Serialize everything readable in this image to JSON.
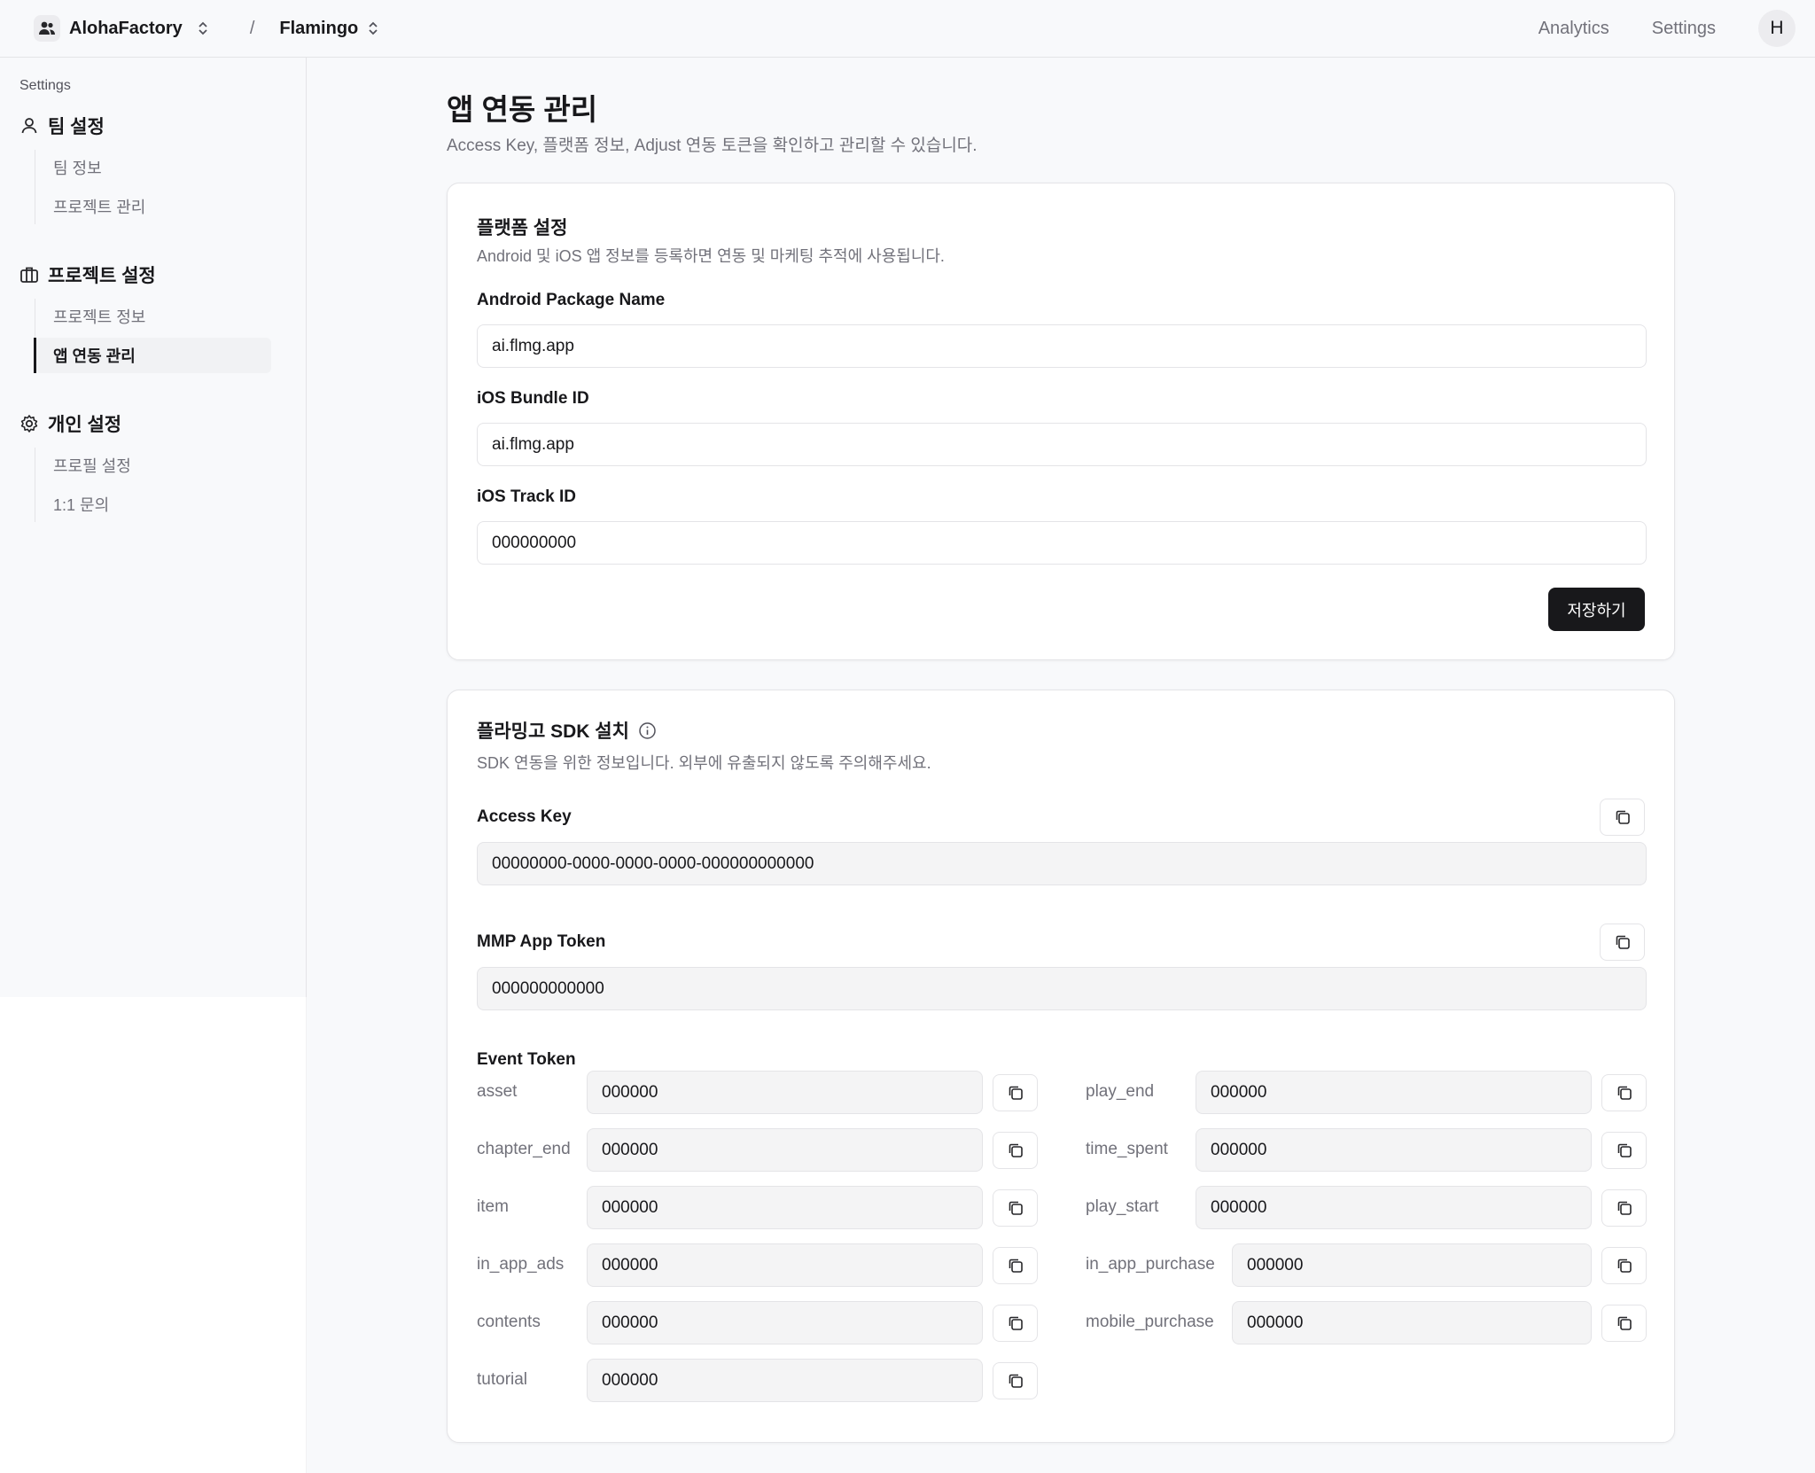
{
  "topbar": {
    "org_name": "AlohaFactory",
    "separator": "/",
    "project_name": "Flamingo",
    "nav": [
      "Analytics",
      "Settings"
    ],
    "user_initial": "H"
  },
  "sidebar": {
    "caption": "Settings",
    "groups": [
      {
        "title": "팀 설정",
        "icon": "person-icon",
        "items": [
          "팀 정보",
          "프로젝트 관리"
        ]
      },
      {
        "title": "프로젝트 설정",
        "icon": "briefcase-icon",
        "items": [
          "프로젝트 정보",
          "앱 연동 관리"
        ]
      },
      {
        "title": "개인 설정",
        "icon": "gear-icon",
        "items": [
          "프로필 설정",
          "1:1 문의"
        ]
      }
    ],
    "active_item": "앱 연동 관리"
  },
  "page": {
    "title": "앱 연동 관리",
    "subtitle": "Access Key, 플랫폼 정보, Adjust 연동 토큰을 확인하고 관리할 수 있습니다."
  },
  "platform": {
    "title": "플랫폼 설정",
    "desc": "Android 및 iOS 앱 정보를 등록하면 연동 및 마케팅 추적에 사용됩니다.",
    "android_label": "Android Package Name",
    "android_value": "ai.flmg.app",
    "ios_bundle_label": "iOS Bundle ID",
    "ios_bundle_value": "ai.flmg.app",
    "ios_track_label": "iOS Track ID",
    "ios_track_value": "000000000",
    "save_label": "저장하기"
  },
  "sdk": {
    "title": "플라밍고 SDK 설치",
    "desc": "SDK 연동을 위한 정보입니다. 외부에 유출되지 않도록 주의해주세요.",
    "access_key_label": "Access Key",
    "access_key_value": "00000000-0000-0000-0000-000000000000",
    "mmp_label": "MMP App Token",
    "mmp_value": "000000000000",
    "event_label": "Event Token",
    "events_left": [
      {
        "name": "asset",
        "value": "000000"
      },
      {
        "name": "chapter_end",
        "value": "000000"
      },
      {
        "name": "item",
        "value": "000000"
      },
      {
        "name": "in_app_ads",
        "value": "000000"
      },
      {
        "name": "contents",
        "value": "000000"
      },
      {
        "name": "tutorial",
        "value": "000000"
      }
    ],
    "events_right": [
      {
        "name": "play_end",
        "value": "000000"
      },
      {
        "name": "time_spent",
        "value": "000000"
      },
      {
        "name": "play_start",
        "value": "000000"
      },
      {
        "name": "in_app_purchase",
        "value": "000000"
      },
      {
        "name": "mobile_purchase",
        "value": "000000"
      }
    ]
  }
}
